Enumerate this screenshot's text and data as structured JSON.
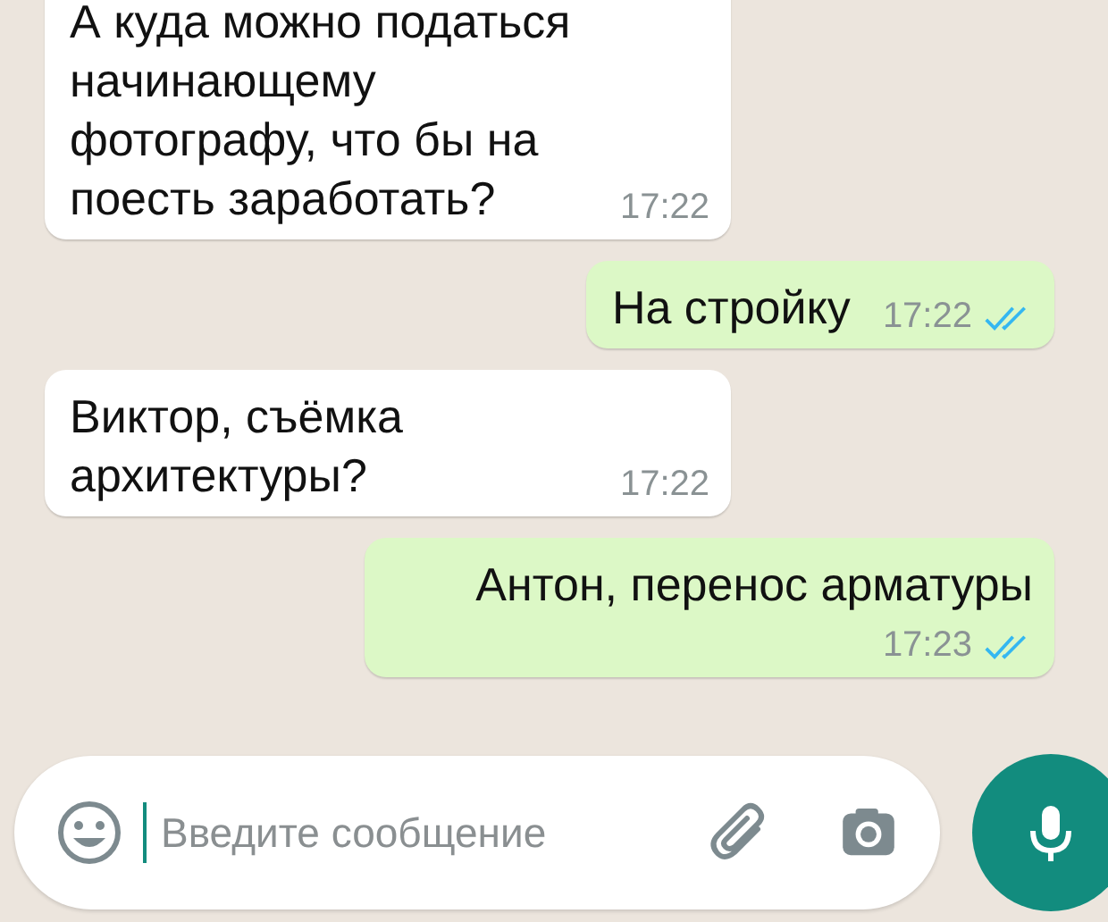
{
  "messages": [
    {
      "kind": "incoming",
      "text": "А куда можно податься начинающему фотографу, что бы на поесть заработать?",
      "time": "17:22"
    },
    {
      "kind": "outgoing",
      "text": "На стройку",
      "time": "17:22",
      "read": true
    },
    {
      "kind": "incoming",
      "text": "Виктор, съёмка архитектуры?",
      "time": "17:22"
    },
    {
      "kind": "outgoing",
      "text": "Антон, перенос арматуры",
      "time": "17:23",
      "read": true
    }
  ],
  "composer": {
    "placeholder": "Введите сообщение"
  }
}
